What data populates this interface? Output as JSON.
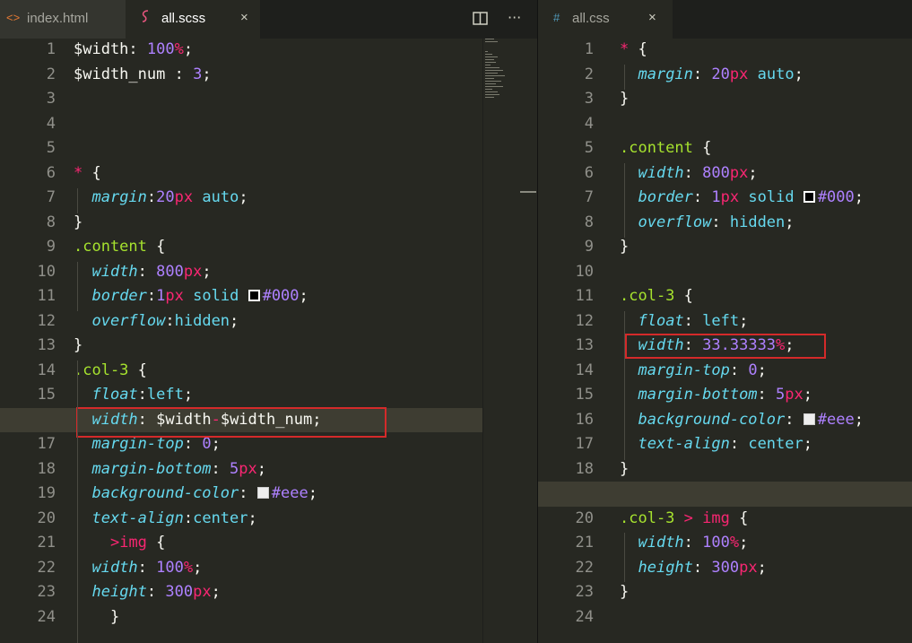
{
  "left_pane": {
    "tabs": [
      {
        "label": "index.html",
        "icon": "code-icon",
        "active": false
      },
      {
        "label": "all.scss",
        "icon": "sass-icon",
        "active": true,
        "close": "×"
      }
    ],
    "toolbar": {
      "split_icon": "split-editor-icon",
      "more": "···"
    },
    "current_line": 16,
    "highlighted_line": 16,
    "lines": [
      [
        [
          "$width",
          "var"
        ],
        [
          ": ",
          "p"
        ],
        [
          "100",
          "num"
        ],
        [
          "%",
          "unit"
        ],
        [
          ";",
          "p"
        ]
      ],
      [
        [
          "$width_num",
          "var"
        ],
        [
          " : ",
          "p"
        ],
        [
          "3",
          "num"
        ],
        [
          ";",
          "p"
        ]
      ],
      [],
      [],
      [],
      [
        [
          "*",
          "tag"
        ],
        [
          " {",
          "p"
        ]
      ],
      [
        [
          "  ",
          "p"
        ],
        [
          "margin",
          "prop"
        ],
        [
          ":",
          "p"
        ],
        [
          "20",
          "num"
        ],
        [
          "px",
          "unit"
        ],
        [
          " ",
          "p"
        ],
        [
          "auto",
          "val"
        ],
        [
          ";",
          "p"
        ]
      ],
      [
        [
          "}",
          "p"
        ]
      ],
      [
        [
          ".content",
          "sel"
        ],
        [
          " {",
          "p"
        ]
      ],
      [
        [
          "  ",
          "p"
        ],
        [
          "width",
          "prop"
        ],
        [
          ": ",
          "p"
        ],
        [
          "800",
          "num"
        ],
        [
          "px",
          "unit"
        ],
        [
          ";",
          "p"
        ]
      ],
      [
        [
          "  ",
          "p"
        ],
        [
          "border",
          "prop"
        ],
        [
          ":",
          "p"
        ],
        [
          "1",
          "num"
        ],
        [
          "px",
          "unit"
        ],
        [
          " ",
          "p"
        ],
        [
          "solid",
          "val"
        ],
        [
          " ",
          "p"
        ],
        [
          "",
          "swatch-black"
        ],
        [
          "#000",
          "num"
        ],
        [
          ";",
          "p"
        ]
      ],
      [
        [
          "  ",
          "p"
        ],
        [
          "overflow",
          "prop"
        ],
        [
          ":",
          "p"
        ],
        [
          "hidden",
          "val"
        ],
        [
          ";",
          "p"
        ]
      ],
      [
        [
          "}",
          "p"
        ]
      ],
      [
        [
          ".col-3",
          "sel"
        ],
        [
          " {",
          "p"
        ]
      ],
      [
        [
          "  ",
          "p"
        ],
        [
          "float",
          "prop"
        ],
        [
          ":",
          "p"
        ],
        [
          "left",
          "val"
        ],
        [
          ";",
          "p"
        ]
      ],
      [
        [
          "  ",
          "p"
        ],
        [
          "width",
          "prop"
        ],
        [
          ": ",
          "p"
        ],
        [
          "$width",
          "var"
        ],
        [
          "-",
          "op"
        ],
        [
          "$width_num",
          "var"
        ],
        [
          ";",
          "p"
        ]
      ],
      [
        [
          "  ",
          "p"
        ],
        [
          "margin-top",
          "prop"
        ],
        [
          ": ",
          "p"
        ],
        [
          "0",
          "num"
        ],
        [
          ";",
          "p"
        ]
      ],
      [
        [
          "  ",
          "p"
        ],
        [
          "margin-bottom",
          "prop"
        ],
        [
          ": ",
          "p"
        ],
        [
          "5",
          "num"
        ],
        [
          "px",
          "unit"
        ],
        [
          ";",
          "p"
        ]
      ],
      [
        [
          "  ",
          "p"
        ],
        [
          "background-color",
          "prop"
        ],
        [
          ": ",
          "p"
        ],
        [
          "",
          "swatch-light"
        ],
        [
          "#eee",
          "num"
        ],
        [
          ";",
          "p"
        ]
      ],
      [
        [
          "  ",
          "p"
        ],
        [
          "text-align",
          "prop"
        ],
        [
          ":",
          "p"
        ],
        [
          "center",
          "val"
        ],
        [
          ";",
          "p"
        ]
      ],
      [
        [
          "    ",
          "p"
        ],
        [
          ">",
          "op"
        ],
        [
          "img",
          "tag"
        ],
        [
          " {",
          "p"
        ]
      ],
      [
        [
          "  ",
          "p"
        ],
        [
          "width",
          "prop"
        ],
        [
          ": ",
          "p"
        ],
        [
          "100",
          "num"
        ],
        [
          "%",
          "unit"
        ],
        [
          ";",
          "p"
        ]
      ],
      [
        [
          "  ",
          "p"
        ],
        [
          "height",
          "prop"
        ],
        [
          ": ",
          "p"
        ],
        [
          "300",
          "num"
        ],
        [
          "px",
          "unit"
        ],
        [
          ";",
          "p"
        ]
      ],
      [
        [
          "    ",
          "p"
        ],
        [
          "}",
          "p"
        ]
      ],
      [
        [
          "  ",
          "p"
        ],
        [
          "...",
          "p"
        ]
      ]
    ]
  },
  "right_pane": {
    "tabs": [
      {
        "label": "all.css",
        "icon": "hash-icon",
        "active": true,
        "close": "×"
      }
    ],
    "current_line": 19,
    "highlighted_line": 13,
    "lines": [
      [
        [
          "*",
          "tag"
        ],
        [
          " {",
          "p"
        ]
      ],
      [
        [
          "  ",
          "p"
        ],
        [
          "margin",
          "prop"
        ],
        [
          ": ",
          "p"
        ],
        [
          "20",
          "num"
        ],
        [
          "px",
          "unit"
        ],
        [
          " ",
          "p"
        ],
        [
          "auto",
          "val"
        ],
        [
          ";",
          "p"
        ]
      ],
      [
        [
          "}",
          "p"
        ]
      ],
      [],
      [
        [
          ".content",
          "sel"
        ],
        [
          " {",
          "p"
        ]
      ],
      [
        [
          "  ",
          "p"
        ],
        [
          "width",
          "prop"
        ],
        [
          ": ",
          "p"
        ],
        [
          "800",
          "num"
        ],
        [
          "px",
          "unit"
        ],
        [
          ";",
          "p"
        ]
      ],
      [
        [
          "  ",
          "p"
        ],
        [
          "border",
          "prop"
        ],
        [
          ": ",
          "p"
        ],
        [
          "1",
          "num"
        ],
        [
          "px",
          "unit"
        ],
        [
          " ",
          "p"
        ],
        [
          "solid",
          "val"
        ],
        [
          " ",
          "p"
        ],
        [
          "",
          "swatch-black"
        ],
        [
          "#000",
          "num"
        ],
        [
          ";",
          "p"
        ]
      ],
      [
        [
          "  ",
          "p"
        ],
        [
          "overflow",
          "prop"
        ],
        [
          ": ",
          "p"
        ],
        [
          "hidden",
          "val"
        ],
        [
          ";",
          "p"
        ]
      ],
      [
        [
          "}",
          "p"
        ]
      ],
      [],
      [
        [
          ".col-3",
          "sel"
        ],
        [
          " {",
          "p"
        ]
      ],
      [
        [
          "  ",
          "p"
        ],
        [
          "float",
          "prop"
        ],
        [
          ": ",
          "p"
        ],
        [
          "left",
          "val"
        ],
        [
          ";",
          "p"
        ]
      ],
      [
        [
          "  ",
          "p"
        ],
        [
          "width",
          "prop"
        ],
        [
          ": ",
          "p"
        ],
        [
          "33.33333",
          "num"
        ],
        [
          "%",
          "unit"
        ],
        [
          ";",
          "p"
        ]
      ],
      [
        [
          "  ",
          "p"
        ],
        [
          "margin-top",
          "prop"
        ],
        [
          ": ",
          "p"
        ],
        [
          "0",
          "num"
        ],
        [
          ";",
          "p"
        ]
      ],
      [
        [
          "  ",
          "p"
        ],
        [
          "margin-bottom",
          "prop"
        ],
        [
          ": ",
          "p"
        ],
        [
          "5",
          "num"
        ],
        [
          "px",
          "unit"
        ],
        [
          ";",
          "p"
        ]
      ],
      [
        [
          "  ",
          "p"
        ],
        [
          "background-color",
          "prop"
        ],
        [
          ": ",
          "p"
        ],
        [
          "",
          "swatch-light"
        ],
        [
          "#eee",
          "num"
        ],
        [
          ";",
          "p"
        ]
      ],
      [
        [
          "  ",
          "p"
        ],
        [
          "text-align",
          "prop"
        ],
        [
          ": ",
          "p"
        ],
        [
          "center",
          "val"
        ],
        [
          ";",
          "p"
        ]
      ],
      [
        [
          "}",
          "p"
        ]
      ],
      [],
      [
        [
          ".col-3",
          "sel"
        ],
        [
          " ",
          "p"
        ],
        [
          ">",
          "op"
        ],
        [
          " ",
          "p"
        ],
        [
          "img",
          "tag"
        ],
        [
          " {",
          "p"
        ]
      ],
      [
        [
          "  ",
          "p"
        ],
        [
          "width",
          "prop"
        ],
        [
          ": ",
          "p"
        ],
        [
          "100",
          "num"
        ],
        [
          "%",
          "unit"
        ],
        [
          ";",
          "p"
        ]
      ],
      [
        [
          "  ",
          "p"
        ],
        [
          "height",
          "prop"
        ],
        [
          ": ",
          "p"
        ],
        [
          "300",
          "num"
        ],
        [
          "px",
          "unit"
        ],
        [
          ";",
          "p"
        ]
      ],
      [
        [
          "}",
          "p"
        ]
      ],
      [],
      [
        [
          "  ",
          "p"
        ],
        [
          "...",
          "p"
        ]
      ]
    ]
  },
  "colors": {
    "background": "#272822",
    "gutter_text": "#90908a",
    "highlight_box": "#d42a2a",
    "selector": "#a6e22e",
    "property": "#66d9ef",
    "number": "#ae81ff",
    "unit": "#f92672"
  }
}
